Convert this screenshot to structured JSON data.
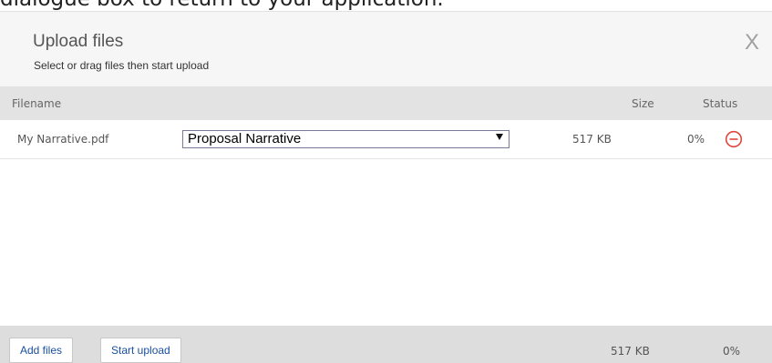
{
  "background": {
    "caption": "dialogue box to return to your application."
  },
  "dialog": {
    "title": "Upload files",
    "subtitle": "Select or drag files then start upload",
    "close_label": "X"
  },
  "table": {
    "headers": {
      "filename": "Filename",
      "size": "Size",
      "status": "Status"
    },
    "rows": [
      {
        "filename": "My Narrative.pdf",
        "document_type": "Proposal Narrative",
        "size": "517 KB",
        "percent": "0%"
      }
    ]
  },
  "footer": {
    "add_files_label": "Add files",
    "start_upload_label": "Start upload",
    "total_size": "517 KB",
    "total_percent": "0%"
  },
  "colors": {
    "remove_icon": "#e0463c",
    "button_text": "#1a4fa0",
    "select_border": "#7a7a9a"
  }
}
